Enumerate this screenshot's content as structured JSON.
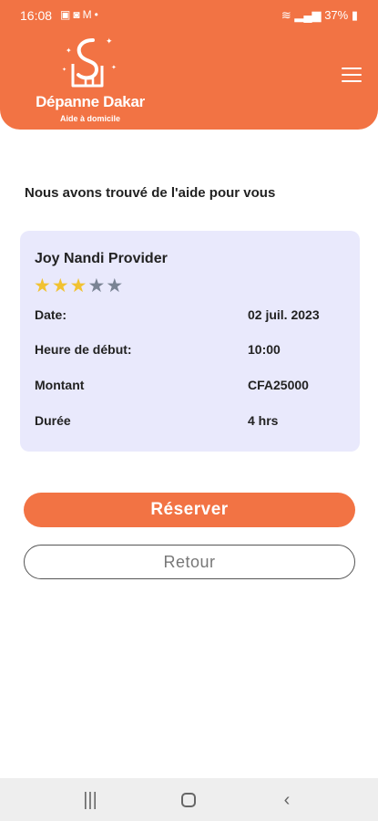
{
  "status_bar": {
    "time": "16:08",
    "icons": [
      "image-icon",
      "beam-icon",
      "gmail-icon",
      "dot-icon"
    ],
    "battery": "37%",
    "right_icons": [
      "wifi-icon",
      "volte-icon",
      "signal-icon",
      "signal-icon",
      "battery-icon"
    ]
  },
  "header": {
    "brand": "Dépanne Dakar",
    "tagline": "Aide à domicile",
    "menu_icon": "hamburger-menu-icon",
    "color": "#f27344"
  },
  "main": {
    "headline": "Nous avons trouvé de l'aide pour vous"
  },
  "card": {
    "provider_name": "Joy Nandi Provider",
    "rating": 3,
    "rating_max": 5,
    "rows": [
      {
        "label": "Date:",
        "value": "02 juil. 2023"
      },
      {
        "label": "Heure de début:",
        "value": "10:00"
      },
      {
        "label": "Montant",
        "value": "CFA25000"
      },
      {
        "label": "Durée",
        "value": "4 hrs"
      }
    ],
    "background": "#e9e9fc"
  },
  "actions": {
    "reserve_label": "Réserver",
    "back_label": "Retour"
  },
  "navbar": {
    "recent_icon": "recent-apps-icon",
    "home_icon": "home-icon",
    "back_icon": "back-icon"
  }
}
